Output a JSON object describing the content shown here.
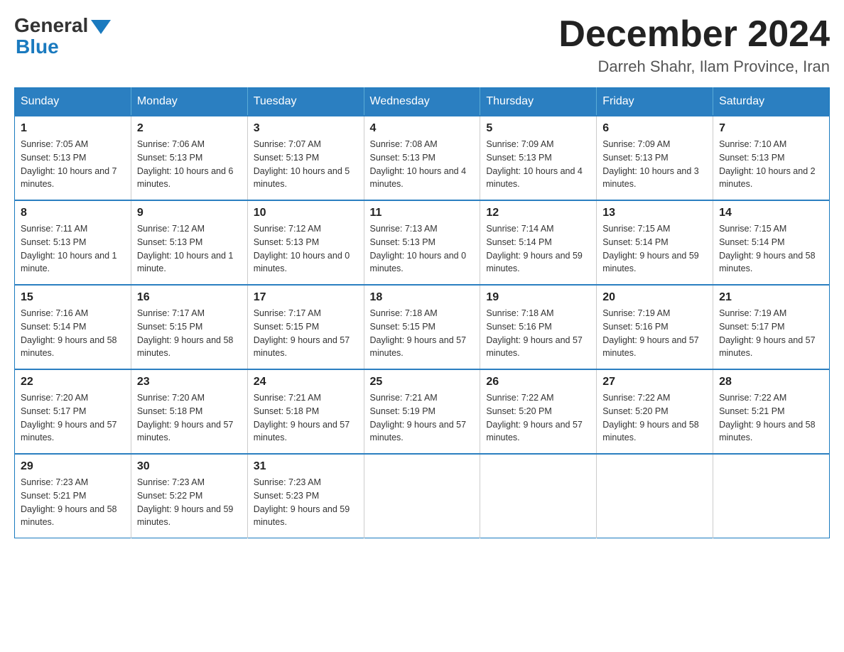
{
  "header": {
    "logo_general": "General",
    "logo_blue": "Blue",
    "month_title": "December 2024",
    "location": "Darreh Shahr, Ilam Province, Iran"
  },
  "days_of_week": [
    "Sunday",
    "Monday",
    "Tuesday",
    "Wednesday",
    "Thursday",
    "Friday",
    "Saturday"
  ],
  "weeks": [
    [
      {
        "day": "1",
        "sunrise": "7:05 AM",
        "sunset": "5:13 PM",
        "daylight": "10 hours and 7 minutes."
      },
      {
        "day": "2",
        "sunrise": "7:06 AM",
        "sunset": "5:13 PM",
        "daylight": "10 hours and 6 minutes."
      },
      {
        "day": "3",
        "sunrise": "7:07 AM",
        "sunset": "5:13 PM",
        "daylight": "10 hours and 5 minutes."
      },
      {
        "day": "4",
        "sunrise": "7:08 AM",
        "sunset": "5:13 PM",
        "daylight": "10 hours and 4 minutes."
      },
      {
        "day": "5",
        "sunrise": "7:09 AM",
        "sunset": "5:13 PM",
        "daylight": "10 hours and 4 minutes."
      },
      {
        "day": "6",
        "sunrise": "7:09 AM",
        "sunset": "5:13 PM",
        "daylight": "10 hours and 3 minutes."
      },
      {
        "day": "7",
        "sunrise": "7:10 AM",
        "sunset": "5:13 PM",
        "daylight": "10 hours and 2 minutes."
      }
    ],
    [
      {
        "day": "8",
        "sunrise": "7:11 AM",
        "sunset": "5:13 PM",
        "daylight": "10 hours and 1 minute."
      },
      {
        "day": "9",
        "sunrise": "7:12 AM",
        "sunset": "5:13 PM",
        "daylight": "10 hours and 1 minute."
      },
      {
        "day": "10",
        "sunrise": "7:12 AM",
        "sunset": "5:13 PM",
        "daylight": "10 hours and 0 minutes."
      },
      {
        "day": "11",
        "sunrise": "7:13 AM",
        "sunset": "5:13 PM",
        "daylight": "10 hours and 0 minutes."
      },
      {
        "day": "12",
        "sunrise": "7:14 AM",
        "sunset": "5:14 PM",
        "daylight": "9 hours and 59 minutes."
      },
      {
        "day": "13",
        "sunrise": "7:15 AM",
        "sunset": "5:14 PM",
        "daylight": "9 hours and 59 minutes."
      },
      {
        "day": "14",
        "sunrise": "7:15 AM",
        "sunset": "5:14 PM",
        "daylight": "9 hours and 58 minutes."
      }
    ],
    [
      {
        "day": "15",
        "sunrise": "7:16 AM",
        "sunset": "5:14 PM",
        "daylight": "9 hours and 58 minutes."
      },
      {
        "day": "16",
        "sunrise": "7:17 AM",
        "sunset": "5:15 PM",
        "daylight": "9 hours and 58 minutes."
      },
      {
        "day": "17",
        "sunrise": "7:17 AM",
        "sunset": "5:15 PM",
        "daylight": "9 hours and 57 minutes."
      },
      {
        "day": "18",
        "sunrise": "7:18 AM",
        "sunset": "5:15 PM",
        "daylight": "9 hours and 57 minutes."
      },
      {
        "day": "19",
        "sunrise": "7:18 AM",
        "sunset": "5:16 PM",
        "daylight": "9 hours and 57 minutes."
      },
      {
        "day": "20",
        "sunrise": "7:19 AM",
        "sunset": "5:16 PM",
        "daylight": "9 hours and 57 minutes."
      },
      {
        "day": "21",
        "sunrise": "7:19 AM",
        "sunset": "5:17 PM",
        "daylight": "9 hours and 57 minutes."
      }
    ],
    [
      {
        "day": "22",
        "sunrise": "7:20 AM",
        "sunset": "5:17 PM",
        "daylight": "9 hours and 57 minutes."
      },
      {
        "day": "23",
        "sunrise": "7:20 AM",
        "sunset": "5:18 PM",
        "daylight": "9 hours and 57 minutes."
      },
      {
        "day": "24",
        "sunrise": "7:21 AM",
        "sunset": "5:18 PM",
        "daylight": "9 hours and 57 minutes."
      },
      {
        "day": "25",
        "sunrise": "7:21 AM",
        "sunset": "5:19 PM",
        "daylight": "9 hours and 57 minutes."
      },
      {
        "day": "26",
        "sunrise": "7:22 AM",
        "sunset": "5:20 PM",
        "daylight": "9 hours and 57 minutes."
      },
      {
        "day": "27",
        "sunrise": "7:22 AM",
        "sunset": "5:20 PM",
        "daylight": "9 hours and 58 minutes."
      },
      {
        "day": "28",
        "sunrise": "7:22 AM",
        "sunset": "5:21 PM",
        "daylight": "9 hours and 58 minutes."
      }
    ],
    [
      {
        "day": "29",
        "sunrise": "7:23 AM",
        "sunset": "5:21 PM",
        "daylight": "9 hours and 58 minutes."
      },
      {
        "day": "30",
        "sunrise": "7:23 AM",
        "sunset": "5:22 PM",
        "daylight": "9 hours and 59 minutes."
      },
      {
        "day": "31",
        "sunrise": "7:23 AM",
        "sunset": "5:23 PM",
        "daylight": "9 hours and 59 minutes."
      },
      null,
      null,
      null,
      null
    ]
  ]
}
